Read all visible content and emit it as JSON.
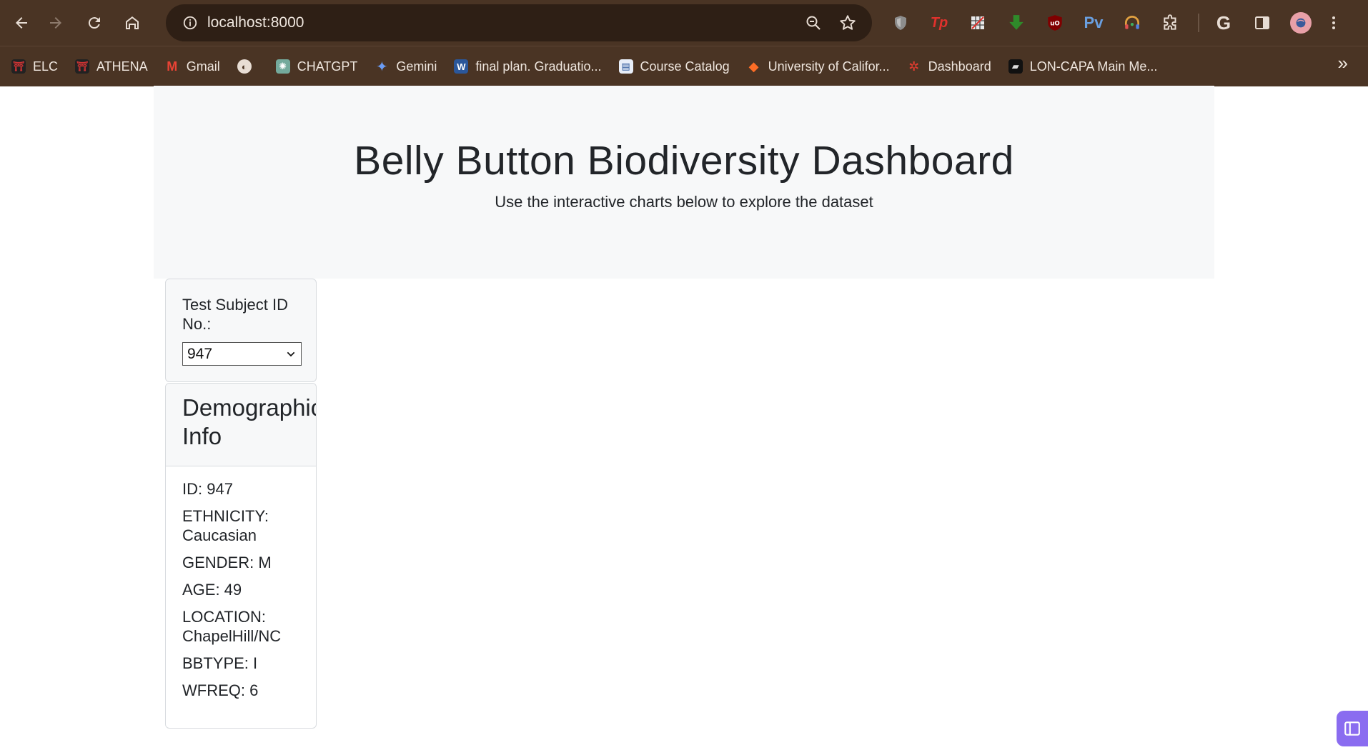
{
  "browser": {
    "url": "localhost:8000",
    "bookmarks": [
      {
        "label": "ELC",
        "icon": "uga-arch-icon"
      },
      {
        "label": "ATHENA",
        "icon": "uga-arch-icon"
      },
      {
        "label": "Gmail",
        "icon": "gmail-icon"
      },
      {
        "label": "",
        "icon": "globe-icon"
      },
      {
        "label": "CHATGPT",
        "icon": "chatgpt-icon"
      },
      {
        "label": "Gemini",
        "icon": "gemini-icon"
      },
      {
        "label": "final plan. Graduatio...",
        "icon": "word-icon"
      },
      {
        "label": "Course Catalog",
        "icon": "document-icon"
      },
      {
        "label": "University of Califor...",
        "icon": "gitlab-icon"
      },
      {
        "label": "Dashboard",
        "icon": "canvas-icon"
      },
      {
        "label": "LON-CAPA Main Me...",
        "icon": "loncapa-icon"
      }
    ],
    "extensions": [
      "shield-icon",
      "tp-icon",
      "crossword-icon",
      "download-icon",
      "ublock-icon",
      "pv-icon",
      "headphones-icon",
      "puzzle-icon"
    ]
  },
  "page": {
    "title": "Belly Button Biodiversity Dashboard",
    "subtitle": "Use the interactive charts below to explore the dataset",
    "select": {
      "label": "Test Subject ID No.:",
      "value": "947"
    },
    "demographics": {
      "title": "Demographic Info",
      "rows": [
        "ID: 947",
        "ETHNICITY: Caucasian",
        "GENDER: M",
        "AGE: 49",
        "LOCATION: ChapelHill/NC",
        "BBTYPE: I",
        "WFREQ: 6"
      ]
    }
  }
}
